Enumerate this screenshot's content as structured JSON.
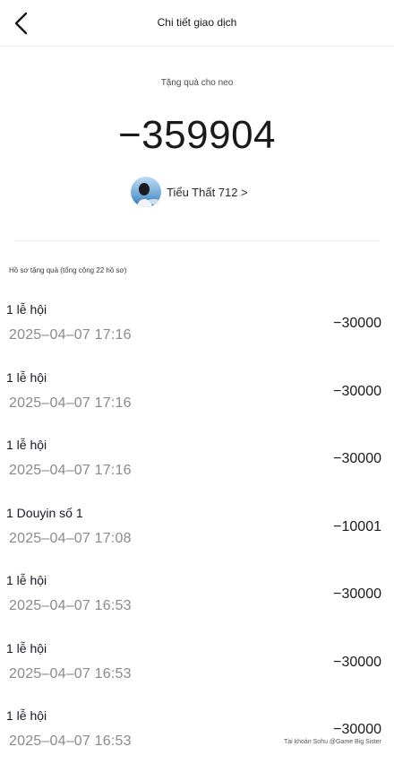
{
  "header": {
    "title": "Chi tiết giao dịch"
  },
  "detail": {
    "subtitle": "Tặng quà cho neo",
    "amount": "−359904",
    "recipient_name": "Tiểu Thất 712 >"
  },
  "records": {
    "header": "Hồ sơ tặng quà (tổng cộng 22 hồ sơ)",
    "items": [
      {
        "title": "1 lễ hội",
        "time": "2025–04–07 17:16",
        "amount": "−30000"
      },
      {
        "title": "1 lễ hội",
        "time": "2025–04–07 17:16",
        "amount": "−30000"
      },
      {
        "title": "1 lễ hội",
        "time": "2025–04–07 17:16",
        "amount": "−30000"
      },
      {
        "title": "1 Douyin số 1",
        "time": "2025–04–07 17:08",
        "amount": "−10001"
      },
      {
        "title": "1 lễ hội",
        "time": "2025–04–07 16:53",
        "amount": "−30000"
      },
      {
        "title": "1 lễ hội",
        "time": "2025–04–07 16:53",
        "amount": "−30000"
      },
      {
        "title": "1 lễ hội",
        "time": "2025–04–07 16:53",
        "amount": "−30000"
      }
    ]
  },
  "watermark": "Tài khoản Sohu @Game Big Sister",
  "icons": {
    "back": "chevron-left-icon",
    "avatar": "avatar-image"
  }
}
